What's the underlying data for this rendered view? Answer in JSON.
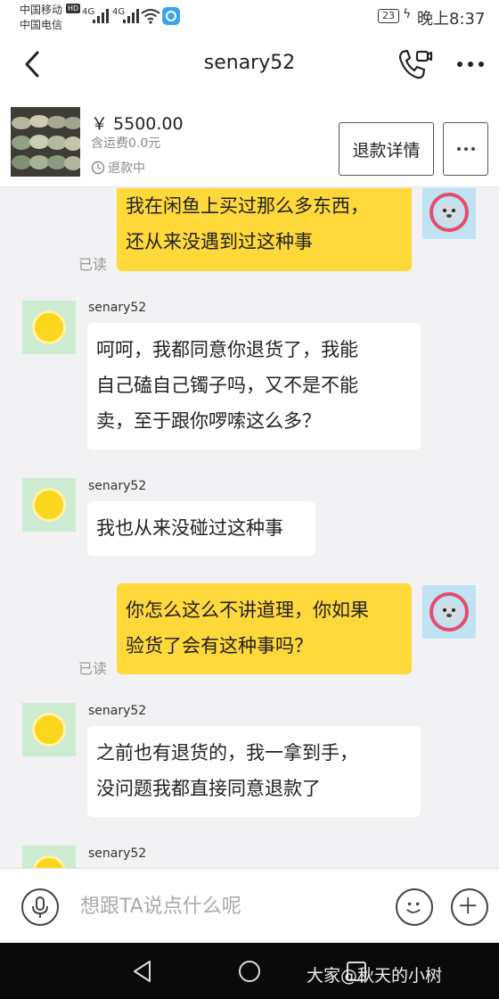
{
  "status_bar": {
    "carrier1": "中国移动",
    "carrier1_badge": "HD",
    "carrier2": "中国电信",
    "signal1": "4G",
    "signal2": "4G",
    "battery": "23",
    "time": "晚上8:37"
  },
  "header": {
    "title": "senary52",
    "icons": [
      "back-arrow-icon",
      "video-call-icon",
      "more-dots-icon"
    ]
  },
  "product": {
    "price": "￥ 5500.00",
    "shipping": "含运费0.0元",
    "status": "退款中",
    "refund_button": "退款详情"
  },
  "messages": [
    {
      "side": "right",
      "text_lines": [
        "我在闲鱼上买过那么多东西，",
        "还从来没遇到过这种事"
      ],
      "read": "已读"
    },
    {
      "side": "left",
      "sender": "senary52",
      "text_lines": [
        "呵呵，我都同意你退货了，我能",
        "自己磕自己镯子吗，又不是不能",
        "卖，至于跟你啰嗦这么多？"
      ]
    },
    {
      "side": "left",
      "sender": "senary52",
      "text_lines": [
        "我也从来没碰过这种事"
      ]
    },
    {
      "side": "right",
      "text_lines": [
        "你怎么这么不讲道理，你如果",
        "验货了会有这种事吗？"
      ],
      "read": "已读"
    },
    {
      "side": "left",
      "sender": "senary52",
      "text_lines": [
        "之前也有退货的，我一拿到手，",
        "没问题我都直接同意退款了"
      ]
    },
    {
      "side": "left",
      "sender": "senary52",
      "text_lines": []
    }
  ],
  "input": {
    "placeholder": "想跟TA说点什么呢"
  },
  "watermark": "大家@秋天的小树",
  "colors": {
    "own_bubble": "#ffd83a",
    "other_bubble": "#ffffff",
    "chat_background": "#f2f2f5"
  }
}
